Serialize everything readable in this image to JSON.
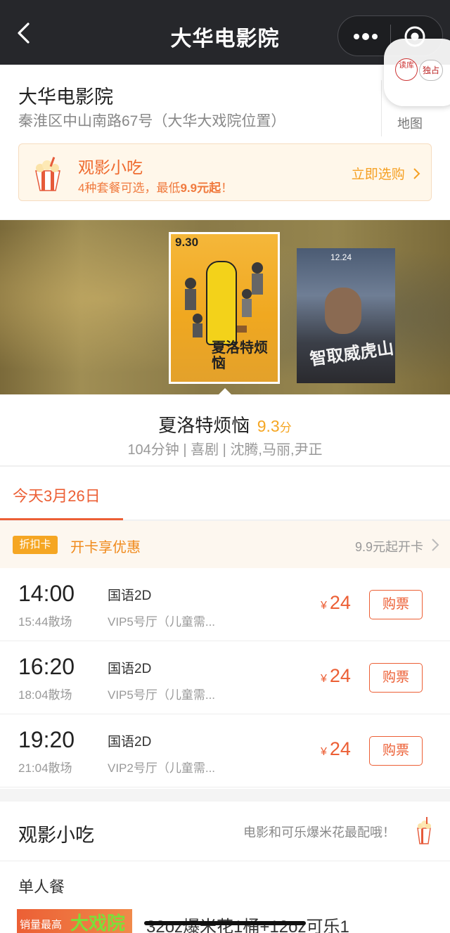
{
  "navbar": {
    "title": "大华电影院"
  },
  "cinema": {
    "name": "大华电影院",
    "address": "秦淮区中山南路67号（大华大戏院位置）",
    "map_label": "地图",
    "floater_logo1": "读库",
    "floater_logo2": "独占"
  },
  "snack_banner": {
    "title": "观影小吃",
    "sub_prefix": "4种套餐可选，最低",
    "sub_price": "9.9元起",
    "sub_suffix": "！",
    "cta": "立即选购"
  },
  "posters": {
    "main": {
      "date": "9.30",
      "title": "夏洛特烦恼"
    },
    "second": {
      "date": "12.24",
      "title": "智取威虎山"
    }
  },
  "movie": {
    "title": "夏洛特烦恼",
    "score": "9.3",
    "score_unit": "分",
    "meta": "104分钟 | 喜剧 | 沈腾,马丽,尹正"
  },
  "date_tab": {
    "label": "今天3月26日"
  },
  "discount": {
    "badge": "折扣卡",
    "text": "开卡享优惠",
    "right": "9.9元起开卡"
  },
  "showtimes": [
    {
      "time": "14:00",
      "end": "15:44散场",
      "lang": "国语2D",
      "hall": "VIP5号厅（儿童需...",
      "currency": "¥",
      "price": "24",
      "buy": "购票"
    },
    {
      "time": "16:20",
      "end": "18:04散场",
      "lang": "国语2D",
      "hall": "VIP5号厅（儿童需...",
      "currency": "¥",
      "price": "24",
      "buy": "购票"
    },
    {
      "time": "19:20",
      "end": "21:04散场",
      "lang": "国语2D",
      "hall": "VIP2号厅（儿童需...",
      "currency": "¥",
      "price": "24",
      "buy": "购票"
    }
  ],
  "snack_section": {
    "title": "观影小吃",
    "right": "电影和可乐爆米花最配哦！",
    "single_label": "单人餐",
    "combo_badge": "销量最高",
    "combo_overlay": "大戏院",
    "combo_name": "32oz爆米花1桶+12oz可乐1"
  },
  "colors": {
    "accent": "#ec5f35",
    "gold": "#f5a623",
    "navbar": "#26272b"
  }
}
